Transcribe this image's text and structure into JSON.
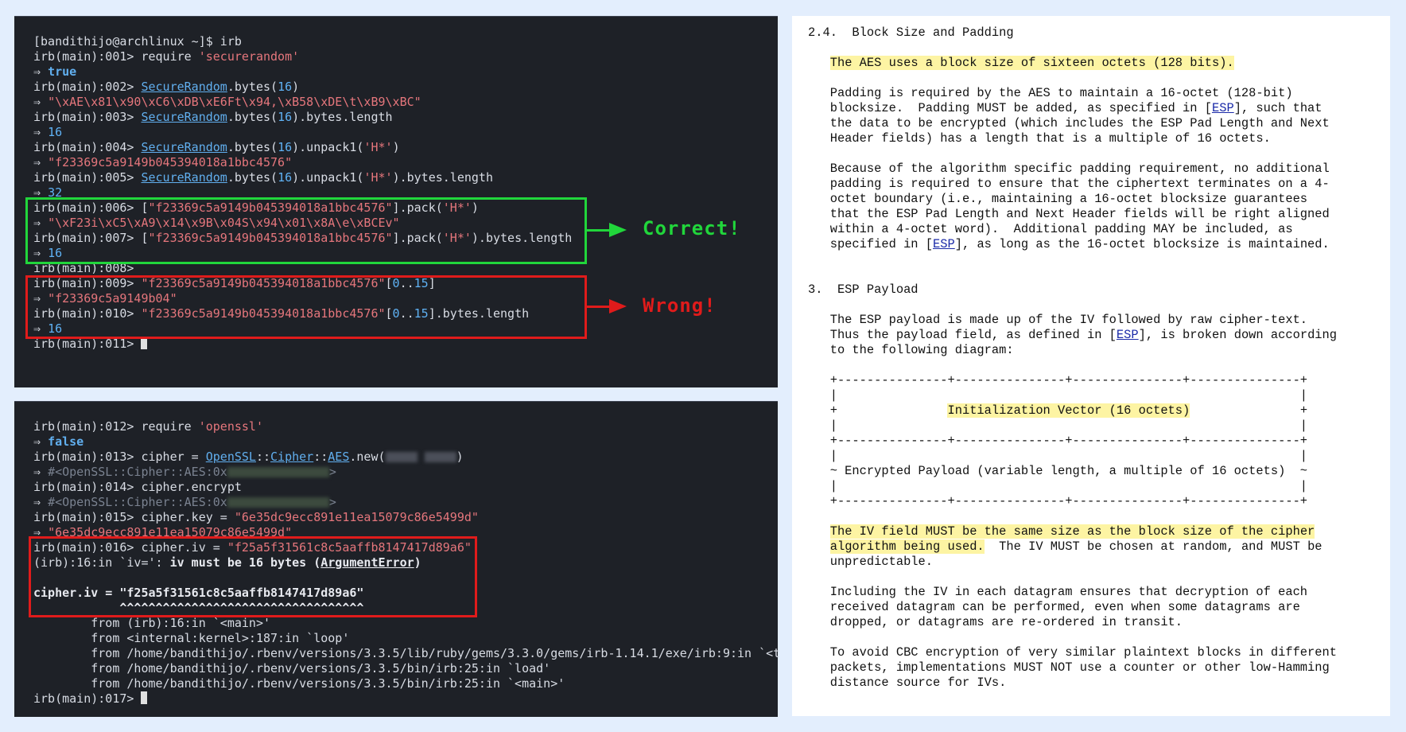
{
  "terminal1": {
    "lines": [
      [
        {
          "t": "[bandithijo@archlinux ~]$ irb"
        }
      ],
      [
        {
          "t": "irb(main):001> require "
        },
        {
          "t": "'securerandom'",
          "c": "s"
        }
      ],
      [
        {
          "t": "⇒ "
        },
        {
          "t": "true",
          "c": "bool"
        }
      ],
      [
        {
          "t": "irb(main):002> "
        },
        {
          "t": "SecureRandom",
          "c": "cls"
        },
        {
          "t": ".bytes("
        },
        {
          "t": "16",
          "c": "num"
        },
        {
          "t": ")"
        }
      ],
      [
        {
          "t": "⇒ "
        },
        {
          "t": "\"\\xAE\\x81\\x90\\xC6\\xDB\\xE6Ft\\x94,\\xB58\\xDE\\t\\xB9\\xBC\"",
          "c": "s"
        }
      ],
      [
        {
          "t": "irb(main):003> "
        },
        {
          "t": "SecureRandom",
          "c": "cls"
        },
        {
          "t": ".bytes("
        },
        {
          "t": "16",
          "c": "num"
        },
        {
          "t": ").bytes.length"
        }
      ],
      [
        {
          "t": "⇒ "
        },
        {
          "t": "16",
          "c": "num"
        }
      ],
      [
        {
          "t": "irb(main):004> "
        },
        {
          "t": "SecureRandom",
          "c": "cls"
        },
        {
          "t": ".bytes("
        },
        {
          "t": "16",
          "c": "num"
        },
        {
          "t": ").unpack1("
        },
        {
          "t": "'H*'",
          "c": "s"
        },
        {
          "t": ")"
        }
      ],
      [
        {
          "t": "⇒ "
        },
        {
          "t": "\"f23369c5a9149b045394018a1bbc4576\"",
          "c": "s"
        }
      ],
      [
        {
          "t": "irb(main):005> "
        },
        {
          "t": "SecureRandom",
          "c": "cls"
        },
        {
          "t": ".bytes("
        },
        {
          "t": "16",
          "c": "num"
        },
        {
          "t": ").unpack1("
        },
        {
          "t": "'H*'",
          "c": "s"
        },
        {
          "t": ").bytes.length"
        }
      ],
      [
        {
          "t": "⇒ "
        },
        {
          "t": "32",
          "c": "num"
        }
      ],
      [
        {
          "t": "irb(main):006> ["
        },
        {
          "t": "\"f23369c5a9149b045394018a1bbc4576\"",
          "c": "s"
        },
        {
          "t": "].pack("
        },
        {
          "t": "'H*'",
          "c": "s"
        },
        {
          "t": ")"
        }
      ],
      [
        {
          "t": "⇒ "
        },
        {
          "t": "\"\\xF23i\\xC5\\xA9\\x14\\x9B\\x04S\\x94\\x01\\x8A\\e\\xBCEv\"",
          "c": "s"
        }
      ],
      [
        {
          "t": "irb(main):007> ["
        },
        {
          "t": "\"f23369c5a9149b045394018a1bbc4576\"",
          "c": "s"
        },
        {
          "t": "].pack("
        },
        {
          "t": "'H*'",
          "c": "s"
        },
        {
          "t": ").bytes.length"
        }
      ],
      [
        {
          "t": "⇒ "
        },
        {
          "t": "16",
          "c": "num"
        }
      ],
      [
        {
          "t": "irb(main):008>"
        }
      ],
      [
        {
          "t": "irb(main):009> "
        },
        {
          "t": "\"f23369c5a9149b045394018a1bbc4576\"",
          "c": "s"
        },
        {
          "t": "["
        },
        {
          "t": "0",
          "c": "num"
        },
        {
          "t": ".."
        },
        {
          "t": "15",
          "c": "num"
        },
        {
          "t": "]"
        }
      ],
      [
        {
          "t": "⇒ "
        },
        {
          "t": "\"f23369c5a9149b04\"",
          "c": "s"
        }
      ],
      [
        {
          "t": "irb(main):010> "
        },
        {
          "t": "\"f23369c5a9149b045394018a1bbc4576\"",
          "c": "s"
        },
        {
          "t": "["
        },
        {
          "t": "0",
          "c": "num"
        },
        {
          "t": ".."
        },
        {
          "t": "15",
          "c": "num"
        },
        {
          "t": "].bytes.length"
        }
      ],
      [
        {
          "t": "⇒ "
        },
        {
          "t": "16",
          "c": "num"
        }
      ],
      [
        {
          "t": "irb(main):011> "
        },
        {
          "t": "",
          "c": "cursor"
        }
      ]
    ],
    "callout_correct": "Correct!",
    "callout_wrong": "Wrong!"
  },
  "terminal2": {
    "lines": [
      [
        {
          "t": "irb(main):012> require "
        },
        {
          "t": "'openssl'",
          "c": "s"
        }
      ],
      [
        {
          "t": "⇒ "
        },
        {
          "t": "false",
          "c": "bool"
        }
      ],
      [
        {
          "t": "irb(main):013> cipher = "
        },
        {
          "t": "OpenSSL",
          "c": "cls"
        },
        {
          "t": "::"
        },
        {
          "t": "Cipher",
          "c": "cls"
        },
        {
          "t": "::"
        },
        {
          "t": "AES",
          "c": "cls"
        },
        {
          "t": ".new("
        },
        {
          "t": "",
          "c": "blur sm"
        },
        {
          "t": " "
        },
        {
          "t": "",
          "c": "blur sm"
        },
        {
          "t": ")"
        }
      ],
      [
        {
          "t": "⇒ "
        },
        {
          "t": "#<OpenSSL::Cipher::AES:0x",
          "c": "dim"
        },
        {
          "t": "",
          "c": "blur"
        },
        {
          "t": ">",
          "c": "dim"
        }
      ],
      [
        {
          "t": "irb(main):014> cipher.encrypt"
        }
      ],
      [
        {
          "t": "⇒ "
        },
        {
          "t": "#<OpenSSL::Cipher::AES:0x",
          "c": "dim"
        },
        {
          "t": "",
          "c": "blur"
        },
        {
          "t": ">",
          "c": "dim"
        }
      ],
      [
        {
          "t": "irb(main):015> cipher.key = "
        },
        {
          "t": "\"6e35dc9ecc891e11ea15079c86e5499d\"",
          "c": "s"
        }
      ],
      [
        {
          "t": "⇒ "
        },
        {
          "t": "\"6e35dc9ecc891e11ea15079c86e5499d\"",
          "c": "s"
        }
      ],
      [
        {
          "t": "irb(main):016> cipher.iv = "
        },
        {
          "t": "\"f25a5f31561c8c5aaffb8147417d89a6\"",
          "c": "s"
        }
      ],
      [
        {
          "t": "(irb):16:in `iv=': "
        },
        {
          "t": "iv must be 16 bytes (",
          "c": "bold"
        },
        {
          "t": "ArgumentError",
          "c": "bold ul"
        },
        {
          "t": ")",
          "c": "bold"
        }
      ],
      [
        {
          "t": ""
        }
      ],
      [
        {
          "t": "cipher.iv = \"f25a5f31561c8c5aaffb8147417d89a6\"",
          "c": "bold"
        }
      ],
      [
        {
          "t": "            ^^^^^^^^^^^^^^^^^^^^^^^^^^^^^^^^^^",
          "c": "bold"
        }
      ],
      [
        {
          "t": "        from (irb):16:in `<main>'"
        }
      ],
      [
        {
          "t": "        from <internal:kernel>:187:in `loop'"
        }
      ],
      [
        {
          "t": "        from /home/bandithijo/.rbenv/versions/3.3.5/lib/ruby/gems/3.3.0/gems/irb-1.14.1/exe/irb:9:in `<t"
        }
      ],
      [
        {
          "t": "        from /home/bandithijo/.rbenv/versions/3.3.5/bin/irb:25:in `load'"
        }
      ],
      [
        {
          "t": "        from /home/bandithijo/.rbenv/versions/3.3.5/bin/irb:25:in `<main>'"
        }
      ],
      [
        {
          "t": "irb(main):017> "
        },
        {
          "t": "",
          "c": "cursor"
        }
      ]
    ]
  },
  "document": {
    "lines": [
      [
        {
          "t": "2.4.  Block Size and Padding"
        }
      ],
      [
        {
          "t": ""
        }
      ],
      [
        {
          "t": "   "
        },
        {
          "t": "The AES uses a block size of sixteen octets (128 bits).",
          "c": "hl"
        }
      ],
      [
        {
          "t": ""
        }
      ],
      [
        {
          "t": "   Padding is required by the AES to maintain a 16-octet (128-bit)"
        }
      ],
      [
        {
          "t": "   blocksize.  Padding MUST be added, as specified in ["
        },
        {
          "t": "ESP",
          "c": "lnk"
        },
        {
          "t": "], such that"
        }
      ],
      [
        {
          "t": "   the data to be encrypted (which includes the ESP Pad Length and Next"
        }
      ],
      [
        {
          "t": "   Header fields) has a length that is a multiple of 16 octets."
        }
      ],
      [
        {
          "t": ""
        }
      ],
      [
        {
          "t": "   Because of the algorithm specific padding requirement, no additional"
        }
      ],
      [
        {
          "t": "   padding is required to ensure that the ciphertext terminates on a 4-"
        }
      ],
      [
        {
          "t": "   octet boundary (i.e., maintaining a 16-octet blocksize guarantees"
        }
      ],
      [
        {
          "t": "   that the ESP Pad Length and Next Header fields will be right aligned"
        }
      ],
      [
        {
          "t": "   within a 4-octet word).  Additional padding MAY be included, as"
        }
      ],
      [
        {
          "t": "   specified in ["
        },
        {
          "t": "ESP",
          "c": "lnk"
        },
        {
          "t": "], as long as the 16-octet blocksize is maintained."
        }
      ],
      [
        {
          "t": ""
        }
      ],
      [
        {
          "t": ""
        }
      ],
      [
        {
          "t": "3.  ESP Payload"
        }
      ],
      [
        {
          "t": ""
        }
      ],
      [
        {
          "t": "   The ESP payload is made up of the IV followed by raw cipher-text."
        }
      ],
      [
        {
          "t": "   Thus the payload field, as defined in ["
        },
        {
          "t": "ESP",
          "c": "lnk"
        },
        {
          "t": "], is broken down according"
        }
      ],
      [
        {
          "t": "   to the following diagram:"
        }
      ],
      [
        {
          "t": ""
        }
      ],
      [
        {
          "t": "   +---------------+---------------+---------------+---------------+"
        }
      ],
      [
        {
          "t": "   |                                                               |"
        }
      ],
      [
        {
          "t": "   +               "
        },
        {
          "t": "Initialization Vector (16 octets)",
          "c": "hl"
        },
        {
          "t": "               +"
        }
      ],
      [
        {
          "t": "   |                                                               |"
        }
      ],
      [
        {
          "t": "   +---------------+---------------+---------------+---------------+"
        }
      ],
      [
        {
          "t": "   |                                                               |"
        }
      ],
      [
        {
          "t": "   ~ Encrypted Payload (variable length, a multiple of 16 octets)  ~"
        }
      ],
      [
        {
          "t": "   |                                                               |"
        }
      ],
      [
        {
          "t": "   +---------------+---------------+---------------+---------------+"
        }
      ],
      [
        {
          "t": ""
        }
      ],
      [
        {
          "t": "   "
        },
        {
          "t": "The IV field MUST be the same size as the block size of the cipher",
          "c": "hl"
        }
      ],
      [
        {
          "t": "   "
        },
        {
          "t": "algorithm being used.",
          "c": "hl"
        },
        {
          "t": "  The IV MUST be chosen at random, and MUST be"
        }
      ],
      [
        {
          "t": "   unpredictable."
        }
      ],
      [
        {
          "t": ""
        }
      ],
      [
        {
          "t": "   Including the IV in each datagram ensures that decryption of each"
        }
      ],
      [
        {
          "t": "   received datagram can be performed, even when some datagrams are"
        }
      ],
      [
        {
          "t": "   dropped, or datagrams are re-ordered in transit."
        }
      ],
      [
        {
          "t": ""
        }
      ],
      [
        {
          "t": "   To avoid CBC encryption of very similar plaintext blocks in different"
        }
      ],
      [
        {
          "t": "   packets, implementations MUST NOT use a counter or other low-Hamming"
        }
      ],
      [
        {
          "t": "   distance source for IVs."
        }
      ]
    ]
  }
}
